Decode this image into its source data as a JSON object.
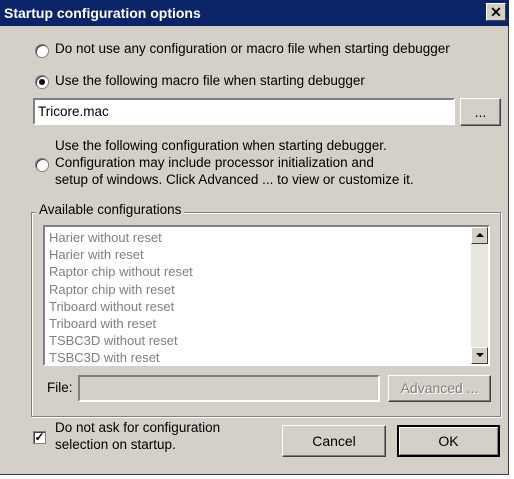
{
  "dialog": {
    "title": "Startup configuration options",
    "close_glyph": "✕"
  },
  "options": {
    "no_file_label": "Do not use any configuration or macro file when starting debugger",
    "macro_label": "Use the following macro file when starting debugger",
    "macro_value": "Tricore.mac",
    "browse_label": "...",
    "config_label_line1": "Use the following configuration when starting debugger.",
    "config_label_line2": "Configuration may include processor initialization and",
    "config_label_line3": "setup of windows. Click Advanced ... to view or customize it.",
    "selected": "macro"
  },
  "configurations": {
    "group_label": "Available configurations",
    "items": [
      "Harier without reset",
      "Harier with reset",
      "Raptor chip without reset",
      "Raptor chip with reset",
      "Triboard without reset",
      "Triboard with reset",
      "TSBC3D without reset",
      "TSBC3D with reset"
    ],
    "file_label": "File:",
    "file_value": "",
    "advanced_label": "Advanced ..."
  },
  "footer": {
    "dont_ask_line1": "Do not ask for configuration",
    "dont_ask_line2": "selection on startup.",
    "dont_ask_checked": true,
    "check_glyph": "✓",
    "cancel_label": "Cancel",
    "ok_label": "OK"
  },
  "colors": {
    "titlebar": "#0a246a",
    "face": "#d4d0c8",
    "disabled_text": "#808080"
  }
}
